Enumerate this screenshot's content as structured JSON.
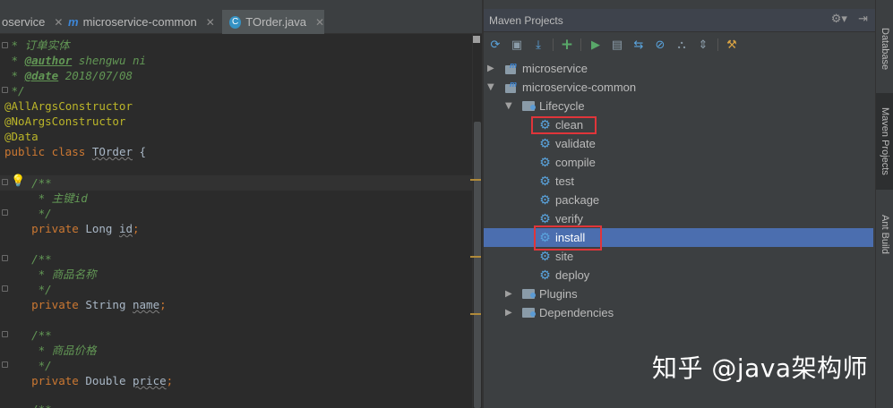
{
  "editor_tabs": [
    {
      "label": "oservice",
      "icon": "module-icon"
    },
    {
      "label": "microservice-common",
      "icon": "module-icon"
    },
    {
      "label": "TOrder.java",
      "icon": "java-class-icon"
    }
  ],
  "editor": {
    "lines": [
      {
        "t": " * 订单实体"
      },
      {
        "t1": " * ",
        "tag": "@author",
        "t2": " shengwu ni"
      },
      {
        "t1": " * ",
        "tag": "@date",
        "t2": " 2018/07/08"
      },
      {
        "t": " */"
      },
      {
        "t": "@AllArgsConstructor"
      },
      {
        "t": "@NoArgsConstructor"
      },
      {
        "t": "@Data"
      },
      {
        "kw": "public class ",
        "name": "TOrder",
        "rest": " {"
      },
      {
        "t": ""
      },
      {
        "t": "    /**"
      },
      {
        "t1": "     * 主键",
        "t2": "id"
      },
      {
        "t": "     */"
      },
      {
        "kw": "    private ",
        "type": "Long ",
        "field": "id",
        "rest": ";"
      },
      {
        "t": ""
      },
      {
        "t": "    /**"
      },
      {
        "t": "     * 商品名称"
      },
      {
        "t": "     */"
      },
      {
        "kw": "    private ",
        "type": "String ",
        "field": "name",
        "rest": ";"
      },
      {
        "t": ""
      },
      {
        "t": "    /**"
      },
      {
        "t": "     * 商品价格"
      },
      {
        "t": "     */"
      },
      {
        "kw": "    private ",
        "type": "Double ",
        "field": "price",
        "rest": ";"
      },
      {
        "t": ""
      },
      {
        "t": "    /**"
      }
    ]
  },
  "maven": {
    "title": "Maven Projects",
    "tree": [
      {
        "label": "microservice",
        "icon": "maven-module-icon"
      },
      {
        "label": "microservice-common",
        "icon": "maven-module-icon"
      },
      {
        "label": "Lifecycle",
        "icon": "lifecycle-folder-icon"
      },
      {
        "label": "clean",
        "icon": "gear-icon"
      },
      {
        "label": "validate",
        "icon": "gear-icon"
      },
      {
        "label": "compile",
        "icon": "gear-icon"
      },
      {
        "label": "test",
        "icon": "gear-icon"
      },
      {
        "label": "package",
        "icon": "gear-icon"
      },
      {
        "label": "verify",
        "icon": "gear-icon"
      },
      {
        "label": "install",
        "icon": "gear-icon"
      },
      {
        "label": "site",
        "icon": "gear-icon"
      },
      {
        "label": "deploy",
        "icon": "gear-icon"
      },
      {
        "label": "Plugins",
        "icon": "plugins-folder-icon"
      },
      {
        "label": "Dependencies",
        "icon": "dependencies-folder-icon"
      }
    ],
    "selected": "install",
    "highlight_color": "#e0353a",
    "selection_color": "#4b6eaf"
  },
  "side_strip": [
    {
      "label": "Database"
    },
    {
      "label": "Maven Projects"
    },
    {
      "label": "Ant Build"
    }
  ],
  "watermark": "知乎 @java架构师"
}
